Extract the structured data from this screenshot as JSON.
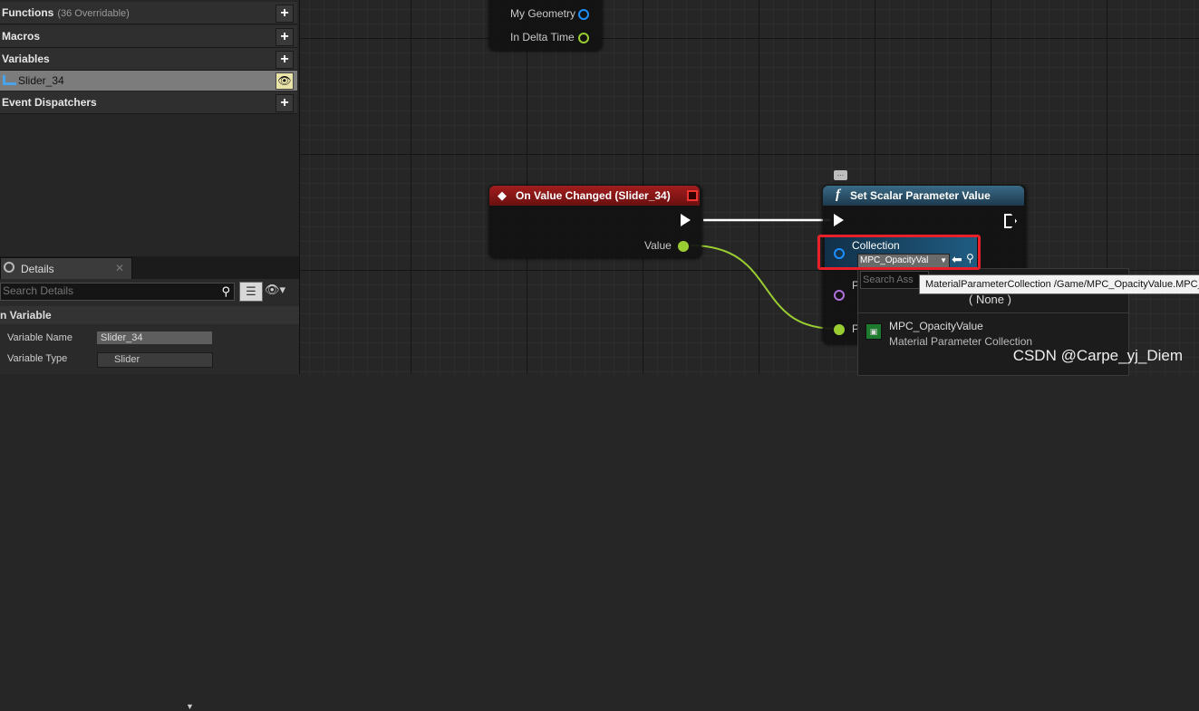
{
  "my_blueprint": {
    "functions": {
      "label": "Functions",
      "sub": "(36 Overridable)"
    },
    "macros": {
      "label": "Macros"
    },
    "variables": {
      "label": "Variables"
    },
    "variable_item": "Slider_34",
    "event_dispatchers": {
      "label": "Event Dispatchers"
    }
  },
  "details": {
    "tab_label": "Details",
    "close_glyph": "✕",
    "search_placeholder": "Search Details",
    "category": "n Variable",
    "props": [
      {
        "key": "Variable Name",
        "value": "Slider_34"
      },
      {
        "key": "Variable Type",
        "value": "Slider"
      }
    ]
  },
  "graph": {
    "tick_node": {
      "pins": [
        "My Geometry",
        "In Delta Time"
      ]
    },
    "event_node": {
      "title": "On Value Changed (Slider_34)",
      "output_pin": "Value"
    },
    "function_node": {
      "title": "Set Scalar Parameter Value",
      "icon": "f",
      "collection_label": "Collection",
      "collection_value": "MPC_OpacityVal",
      "hidden_pin_1": "P",
      "hidden_pin_2": "P"
    },
    "asset_picker": {
      "search_placeholder": "Search Ass",
      "none_label": "( None )",
      "item_name": "MPC_OpacityValue",
      "item_type": "Material Parameter Collection"
    },
    "tooltip": "MaterialParameterCollection /Game/MPC_OpacityValue.MPC_OpacityValue"
  },
  "watermark": "CSDN @Carpe_yj_Diem",
  "colors": {
    "accent_red": "#e8202a",
    "event_header": "#a21d1d",
    "function_header": "#3a6a86",
    "float_pin": "#9acd32",
    "object_pin": "#1e8fff"
  }
}
